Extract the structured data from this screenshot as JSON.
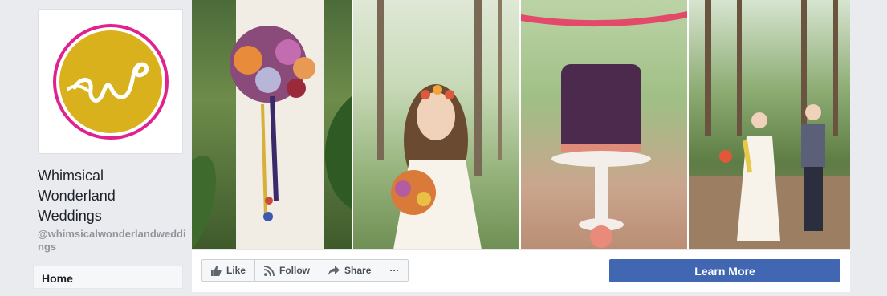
{
  "page": {
    "name_lines": [
      "Whimsical",
      "Wonderland",
      "Weddings"
    ],
    "handle": "@whimsicalwonderlandweddings",
    "logo_letters": "w"
  },
  "nav": {
    "home": "Home"
  },
  "actions": {
    "like": "Like",
    "follow": "Follow",
    "share": "Share",
    "more": "···",
    "cta": "Learn More"
  },
  "colors": {
    "logo_yellow": "#d8b11c",
    "logo_ring": "#e0228f",
    "cta_blue": "#4267b2"
  },
  "cover": {
    "photos": [
      {
        "subject": "bouquet-with-ribbons"
      },
      {
        "subject": "bride-with-flower-crown"
      },
      {
        "subject": "purple-wedding-cake"
      },
      {
        "subject": "couple-in-forest"
      }
    ]
  }
}
